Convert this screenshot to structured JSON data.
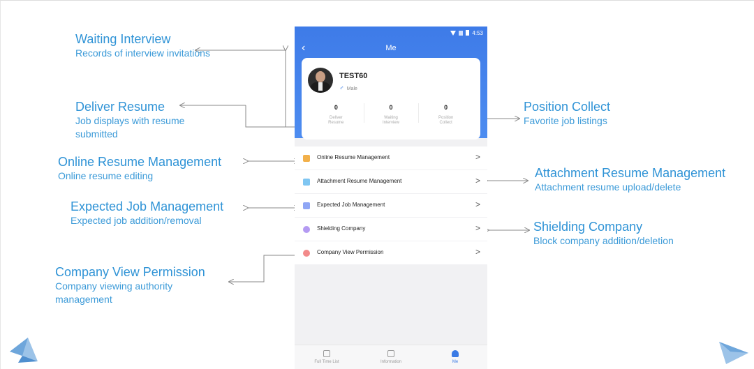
{
  "annotations": {
    "waiting_interview": {
      "title": "Waiting Interview",
      "desc": "Records of interview invitations"
    },
    "deliver_resume": {
      "title": "Deliver Resume",
      "desc": "Job displays with resume submitted"
    },
    "online_resume": {
      "title": "Online Resume Management",
      "desc": "Online resume editing"
    },
    "expected_job": {
      "title": "Expected Job Management",
      "desc": "Expected job addition/removal"
    },
    "company_view": {
      "title": "Company View Permission",
      "desc": "Company viewing authority management"
    },
    "position_collect": {
      "title": "Position Collect",
      "desc": "Favorite job listings"
    },
    "attachment_resume": {
      "title": "Attachment Resume Management",
      "desc": "Attachment resume upload/delete"
    },
    "shielding_company": {
      "title": "Shielding Company",
      "desc": "Block company addition/deletion"
    }
  },
  "phone": {
    "status_time": "4:53",
    "title": "Me",
    "back_icon": "chevron-left-icon",
    "profile": {
      "name": "TEST60",
      "gender": "Male",
      "gender_symbol": "♂"
    },
    "stats": [
      {
        "value": "0",
        "label_line1": "Deliver",
        "label_line2": "Resume"
      },
      {
        "value": "0",
        "label_line1": "Waiting",
        "label_line2": "Interview"
      },
      {
        "value": "0",
        "label_line1": "Position",
        "label_line2": "Collect"
      }
    ],
    "menu": [
      {
        "label": "Online Resume Management",
        "icon": "document-icon",
        "color": "#f2b04a"
      },
      {
        "label": "Attachment Resume Management",
        "icon": "attachment-icon",
        "color": "#7fc6f2"
      },
      {
        "label": "Expected Job Management",
        "icon": "target-icon",
        "color": "#8fa6f5"
      },
      {
        "label": "Shielding Company",
        "icon": "shield-icon",
        "color": "#b49af2"
      },
      {
        "label": "Company View Permission",
        "icon": "eye-icon",
        "color": "#f28a8a"
      }
    ],
    "tabs": [
      {
        "label": "Full Time List",
        "icon": "monitor-icon"
      },
      {
        "label": "Information",
        "icon": "news-icon"
      },
      {
        "label": "Me",
        "icon": "person-icon",
        "active": true
      }
    ]
  },
  "colors": {
    "accent": "#2f93d6",
    "header": "#3e7be8"
  }
}
